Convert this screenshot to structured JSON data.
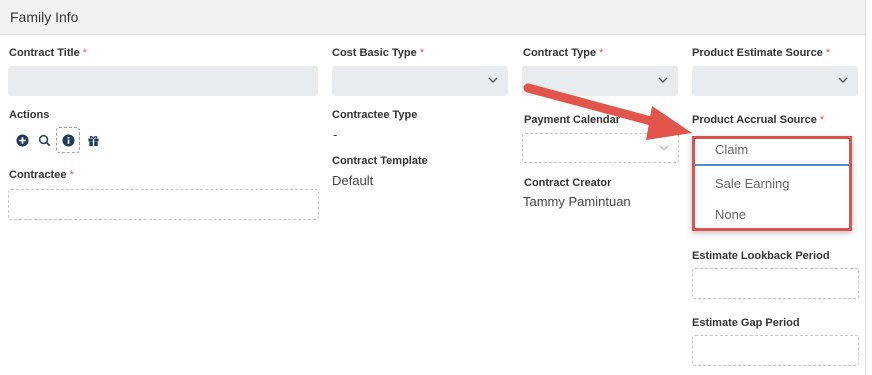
{
  "section": {
    "title": "Family Info"
  },
  "fields": {
    "contract_title": {
      "label": "Contract Title",
      "required": "*",
      "value": ""
    },
    "cost_basic_type": {
      "label": "Cost Basic Type",
      "required": "*",
      "value": ""
    },
    "contract_type": {
      "label": "Contract Type",
      "required": "*",
      "value": ""
    },
    "product_estimate_source": {
      "label": "Product Estimate Source",
      "required": "*",
      "value": ""
    },
    "actions": {
      "label": "Actions"
    },
    "contractee_type": {
      "label": "Contractee Type",
      "value": "-"
    },
    "contract_template": {
      "label": "Contract Template",
      "value": "Default"
    },
    "payment_calendar": {
      "label": "Payment Calendar",
      "value": ""
    },
    "product_accrual_source": {
      "label": "Product Accrual Source",
      "required": "*"
    },
    "contractee": {
      "label": "Contractee",
      "required": "*",
      "value": ""
    },
    "contract_creator": {
      "label": "Contract Creator",
      "value": "Tammy Pamintuan"
    },
    "estimate_lookback_period": {
      "label": "Estimate Lookback Period",
      "value": ""
    },
    "estimate_gap_period": {
      "label": "Estimate Gap Period",
      "value": ""
    }
  },
  "accrual_options": [
    "Claim",
    "Sale Earning",
    "None"
  ],
  "action_icons": [
    "plus-circle-icon",
    "search-icon",
    "info-circle-icon",
    "gift-icon"
  ],
  "colors": {
    "required": "#e35454",
    "highlight": "#d9534f",
    "selected_underline": "#4a8fd4",
    "input_fill": "#e9ecef"
  }
}
